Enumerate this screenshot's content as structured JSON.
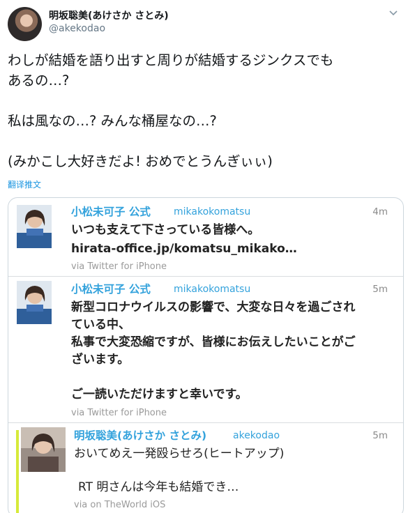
{
  "header": {
    "name": "明坂聡美(あけさか さとみ)",
    "handle": "@akekodao"
  },
  "tweet": {
    "lines": [
      "わしが結婚を語り出すと周りが結婚するジンクスでも",
      "あるの…?",
      "",
      "私は風なの…? みんな桶屋なの…?",
      "",
      "(みかこし大好きだよ! おめでとうんぎぃぃ)"
    ],
    "translate": "翻译推文"
  },
  "embed": {
    "cards": [
      {
        "name": "小松未可子 公式",
        "handle": "mikakokomatsu",
        "time": "4m",
        "body": [
          "いつも支えて下さっている皆様へ。",
          "hirata-office.jp/komatsu_mikako…"
        ],
        "via": "via Twitter for iPhone"
      },
      {
        "name": "小松未可子 公式",
        "handle": "mikakokomatsu",
        "time": "5m",
        "body": [
          "新型コロナウイルスの影響で、大変な日々を過ごされ",
          "ている中、",
          "私事で大変恐縮ですが、皆様にお伝えしたいことがご",
          "ざいます。",
          "",
          "ご一読いただけますと幸いです。"
        ],
        "via": "via Twitter for iPhone"
      },
      {
        "name": "明坂聡美(あけさか さとみ)",
        "handle": "akekodao",
        "time": "5m",
        "body": [
          "おいてめえ一発殴らせろ(ヒートアップ)",
          "",
          "RT 明さんは今年も結婚でき…"
        ],
        "via": "via on TheWorld iOS"
      }
    ]
  }
}
